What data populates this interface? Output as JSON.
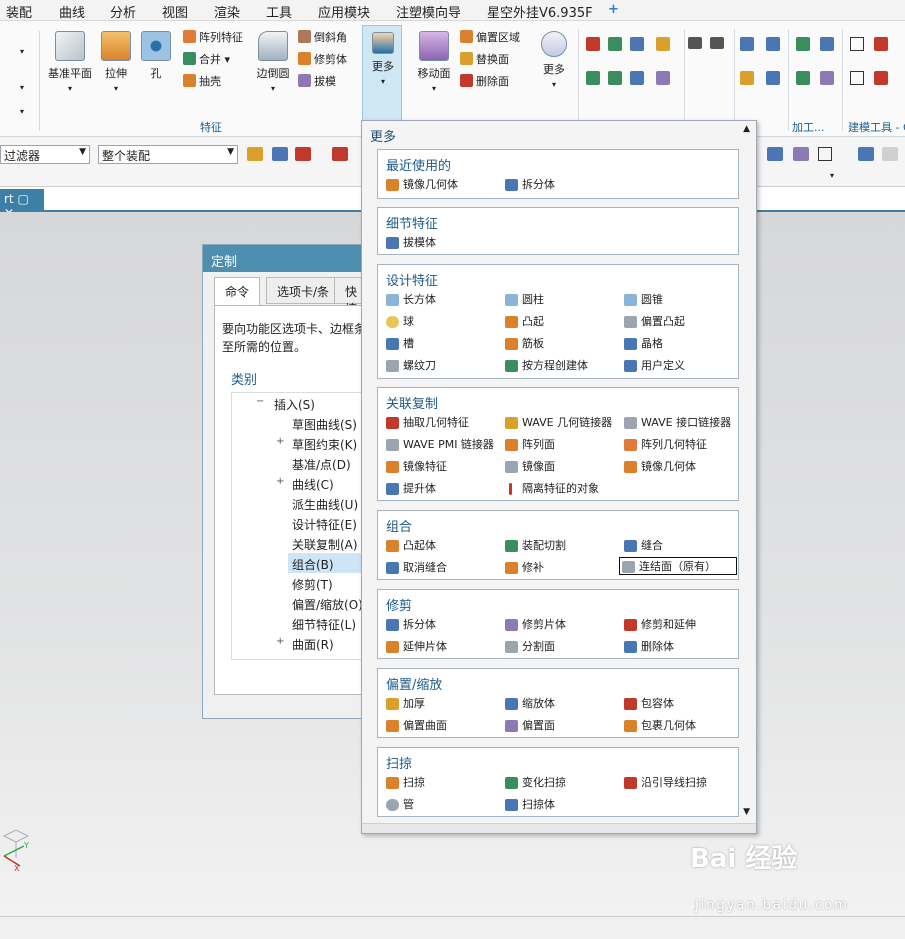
{
  "menubar": {
    "items": [
      "装配",
      "曲线",
      "分析",
      "视图",
      "渲染",
      "工具",
      "应用模块",
      "注塑模向导",
      "星空外挂V6.935F"
    ],
    "add_icon": "plus-icon"
  },
  "ribbon": {
    "big_buttons": [
      {
        "label": "基准平面",
        "icon": "plane-icon"
      },
      {
        "label": "拉伸",
        "icon": "extrude-icon"
      },
      {
        "label": "孔",
        "icon": "hole-icon"
      },
      {
        "label": "边倒圆",
        "icon": "edge-blend-icon"
      },
      {
        "label": "更多",
        "icon": "more-icon"
      },
      {
        "label": "移动面",
        "icon": "move-face-icon"
      },
      {
        "label": "更多",
        "icon": "more-icon"
      }
    ],
    "small_buttons": [
      "阵列特征",
      "合并",
      "抽壳",
      "倒斜角",
      "修剪体",
      "拔模",
      "偏置区域",
      "替换面",
      "删除面"
    ],
    "group_feature": "特征",
    "group_process": "加工...",
    "group_model_tool": "建模工具 - G"
  },
  "toolbar2": {
    "filter_label": "过滤器",
    "assembly_scope": "整个装配"
  },
  "doc_tab": {
    "label": "rt"
  },
  "dialog": {
    "title": "定制",
    "tabs": [
      "命令",
      "选项卡/条",
      "快捷"
    ],
    "instruction": "要向功能区选项卡、边框条拖至所需的位置。",
    "category_label": "类别",
    "tree": [
      {
        "label": "插入(S)",
        "expand": "−"
      },
      {
        "label": "草图曲线(S)",
        "expand": ""
      },
      {
        "label": "草图约束(K)",
        "expand": "+"
      },
      {
        "label": "基准/点(D)",
        "expand": ""
      },
      {
        "label": "曲线(C)",
        "expand": "+"
      },
      {
        "label": "派生曲线(U)",
        "expand": ""
      },
      {
        "label": "设计特征(E)",
        "expand": ""
      },
      {
        "label": "关联复制(A)",
        "expand": ""
      },
      {
        "label": "组合(B)",
        "expand": "",
        "selected": true
      },
      {
        "label": "修剪(T)",
        "expand": ""
      },
      {
        "label": "偏置/缩放(O)",
        "expand": ""
      },
      {
        "label": "细节特征(L)",
        "expand": ""
      },
      {
        "label": "曲面(R)",
        "expand": "+"
      }
    ]
  },
  "popup": {
    "title": "更多",
    "groups": [
      {
        "title": "最近使用的",
        "items": [
          "镜像几何体",
          "拆分体"
        ]
      },
      {
        "title": "细节特征",
        "items": [
          "拔模体"
        ]
      },
      {
        "title": "设计特征",
        "items": [
          "长方体",
          "圆柱",
          "圆锥",
          "球",
          "凸起",
          "偏置凸起",
          "槽",
          "筋板",
          "晶格",
          "螺纹刀",
          "按方程创建体",
          "用户定义"
        ]
      },
      {
        "title": "关联复制",
        "items": [
          "抽取几何特征",
          "WAVE 几何链接器",
          "WAVE 接口链接器",
          "WAVE PMI 链接器",
          "阵列面",
          "阵列几何特征",
          "镜像特征",
          "镜像面",
          "镜像几何体",
          "提升体",
          "隔离特征的对象"
        ]
      },
      {
        "title": "组合",
        "items": [
          "凸起体",
          "装配切割",
          "缝合",
          "取消缝合",
          "修补",
          "连结面（原有）"
        ]
      },
      {
        "title": "修剪",
        "items": [
          "拆分体",
          "修剪片体",
          "修剪和延伸",
          "延伸片体",
          "分割面",
          "删除体"
        ]
      },
      {
        "title": "偏置/缩放",
        "items": [
          "加厚",
          "缩放体",
          "包容体",
          "偏置曲面",
          "偏置面",
          "包裹几何体"
        ]
      },
      {
        "title": "扫掠",
        "items": [
          "扫掠",
          "变化扫掠",
          "沿引导线扫掠",
          "管",
          "扫掠体"
        ]
      }
    ]
  },
  "watermark": {
    "text": "Bai 经验",
    "url": "jingyan.baidu.com"
  },
  "colors": {
    "accent": "#3d7fa6",
    "dialog_title": "#4e8fb0",
    "group_title": "#1d5a8a",
    "selected": "#cde5f7"
  }
}
